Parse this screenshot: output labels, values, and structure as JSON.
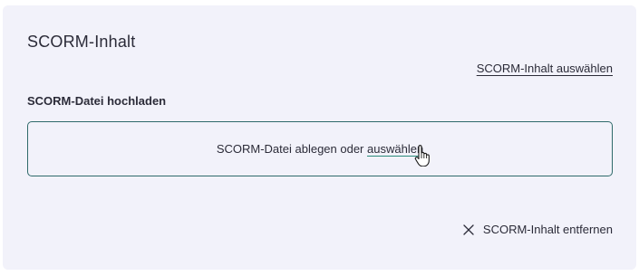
{
  "card": {
    "title": "SCORM-Inhalt",
    "select_link_label": "SCORM-Inhalt auswählen",
    "upload_label": "SCORM-Datei hochladen",
    "dropzone": {
      "text": "SCORM-Datei ablegen oder ",
      "link_label": "auswählen"
    },
    "remove_button_label": "SCORM-Inhalt entfernen",
    "icons": {
      "remove": "close-icon",
      "cursor": "hand-pointer-icon"
    }
  },
  "colors": {
    "card_background": "#f2f2fa",
    "dropzone_border": "#2f6a6a",
    "link_underline_accent": "#2a8a7a",
    "text": "#2b2b38"
  }
}
